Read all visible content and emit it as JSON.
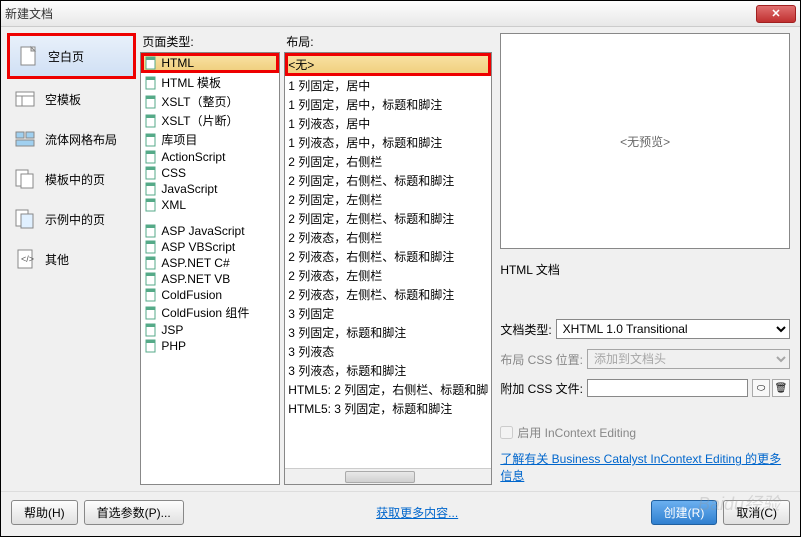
{
  "title": "新建文档",
  "categories": [
    {
      "label": "空白页",
      "selected": true
    },
    {
      "label": "空模板"
    },
    {
      "label": "流体网格布局"
    },
    {
      "label": "模板中的页"
    },
    {
      "label": "示例中的页"
    },
    {
      "label": "其他"
    }
  ],
  "page_type": {
    "header": "页面类型:",
    "items": [
      {
        "label": "HTML",
        "selected": true
      },
      {
        "label": "HTML 模板"
      },
      {
        "label": "XSLT（整页）"
      },
      {
        "label": "XSLT（片断）"
      },
      {
        "label": "库项目"
      },
      {
        "label": "ActionScript"
      },
      {
        "label": "CSS"
      },
      {
        "label": "JavaScript"
      },
      {
        "label": "XML"
      },
      {
        "spacer": true
      },
      {
        "label": "ASP JavaScript"
      },
      {
        "label": "ASP VBScript"
      },
      {
        "label": "ASP.NET C#"
      },
      {
        "label": "ASP.NET VB"
      },
      {
        "label": "ColdFusion"
      },
      {
        "label": "ColdFusion 组件"
      },
      {
        "label": "JSP"
      },
      {
        "label": "PHP"
      }
    ]
  },
  "layout": {
    "header": "布局:",
    "items": [
      {
        "label": "<无>",
        "selected": true
      },
      {
        "label": "1 列固定，居中"
      },
      {
        "label": "1 列固定，居中，标题和脚注"
      },
      {
        "label": "1 列液态，居中"
      },
      {
        "label": "1 列液态，居中，标题和脚注"
      },
      {
        "label": "2 列固定，右侧栏"
      },
      {
        "label": "2 列固定，右侧栏、标题和脚注"
      },
      {
        "label": "2 列固定，左侧栏"
      },
      {
        "label": "2 列固定，左侧栏、标题和脚注"
      },
      {
        "label": "2 列液态，右侧栏"
      },
      {
        "label": "2 列液态，右侧栏、标题和脚注"
      },
      {
        "label": "2 列液态，左侧栏"
      },
      {
        "label": "2 列液态，左侧栏、标题和脚注"
      },
      {
        "label": "3 列固定"
      },
      {
        "label": "3 列固定，标题和脚注"
      },
      {
        "label": "3 列液态"
      },
      {
        "label": "3 列液态，标题和脚注"
      },
      {
        "label": "HTML5: 2 列固定，右侧栏、标题和脚"
      },
      {
        "label": "HTML5: 3 列固定，标题和脚注"
      }
    ]
  },
  "preview": {
    "text": "<无预览>",
    "desc": "HTML 文档"
  },
  "form": {
    "doctype_label": "文档类型:",
    "doctype_value": "XHTML 1.0 Transitional",
    "css_pos_label": "布局 CSS 位置:",
    "css_pos_value": "添加到文档头",
    "attach_css_label": "附加 CSS 文件:",
    "incontext_label": "启用 InContext Editing",
    "link_text": "了解有关 Business Catalyst InContext Editing 的更多信息"
  },
  "footer": {
    "help": "帮助(H)",
    "prefs": "首选参数(P)...",
    "more": "获取更多内容...",
    "create": "创建(R)",
    "cancel": "取消(C)"
  }
}
